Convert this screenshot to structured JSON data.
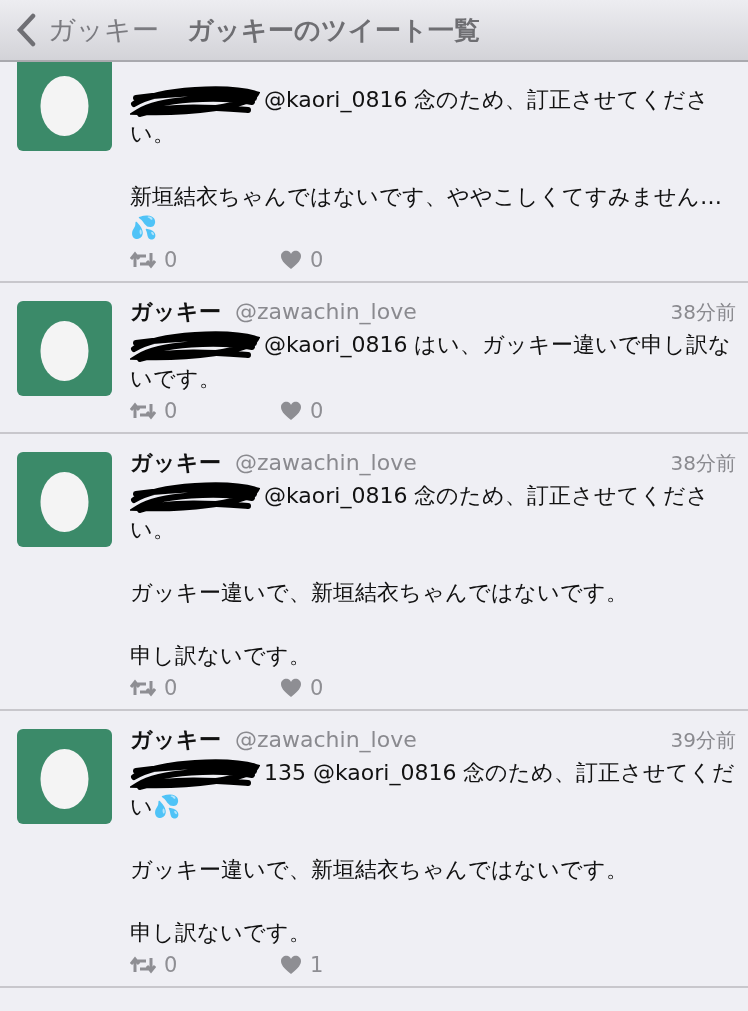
{
  "nav_bar": {
    "back_label": "ガッキー",
    "title": "ガッキーのツイート一覧"
  },
  "tweets": [
    {
      "redacted": true,
      "paragraphs": [
        "@kaori_0816 念のため、訂正させてください。",
        "新垣結衣ちゃんではないです、ややこしくてすみません…💦"
      ],
      "retweets": "0",
      "likes": "0"
    },
    {
      "name": "ガッキー",
      "handle": "@zawachin_love",
      "time": "38分前",
      "redacted": true,
      "paragraphs": [
        "@kaori_0816 はい、ガッキー違いで申し訳ないです。"
      ],
      "retweets": "0",
      "likes": "0"
    },
    {
      "name": "ガッキー",
      "handle": "@zawachin_love",
      "time": "38分前",
      "redacted": true,
      "paragraphs": [
        "@kaori_0816 念のため、訂正させてください。",
        "ガッキー違いで、新垣結衣ちゃんではないです。",
        "申し訳ないです。"
      ],
      "retweets": "0",
      "likes": "0"
    },
    {
      "name": "ガッキー",
      "handle": "@zawachin_love",
      "time": "39分前",
      "redacted": true,
      "paragraphs": [
        "135 @kaori_0816 念のため、訂正させてくだい💦",
        "ガッキー違いで、新垣結衣ちゃんではないです。",
        "申し訳ないです。"
      ],
      "retweets": "0",
      "likes": "1"
    }
  ]
}
